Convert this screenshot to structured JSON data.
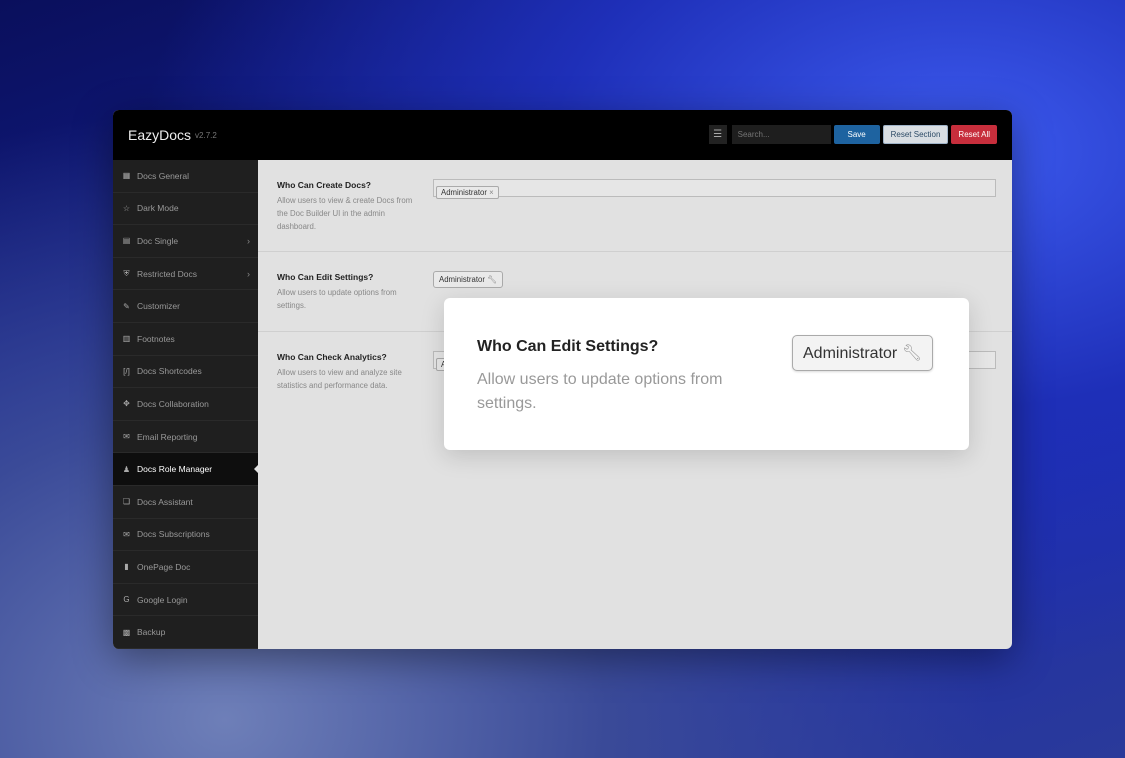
{
  "header": {
    "brand": "EazyDocs",
    "version": "v2.7.2",
    "search_placeholder": "Search...",
    "save": "Save",
    "reset_section": "Reset Section",
    "reset_all": "Reset All"
  },
  "sidebar": {
    "items": [
      {
        "label": "Docs General",
        "icon": "▦"
      },
      {
        "label": "Dark Mode",
        "icon": "☆"
      },
      {
        "label": "Doc Single",
        "icon": "▤",
        "chevron": "›"
      },
      {
        "label": "Restricted Docs",
        "icon": "⛨",
        "chevron": "›"
      },
      {
        "label": "Customizer",
        "icon": "✎"
      },
      {
        "label": "Footnotes",
        "icon": "▥"
      },
      {
        "label": "Docs Shortcodes",
        "icon": "[/]"
      },
      {
        "label": "Docs Collaboration",
        "icon": "✥"
      },
      {
        "label": "Email Reporting",
        "icon": "✉"
      },
      {
        "label": "Docs Role Manager",
        "icon": "♟"
      },
      {
        "label": "Docs Assistant",
        "icon": "❏"
      },
      {
        "label": "Docs Subscriptions",
        "icon": "✉"
      },
      {
        "label": "OnePage Doc",
        "icon": "▮"
      },
      {
        "label": "Google Login",
        "icon": "G"
      },
      {
        "label": "Backup",
        "icon": "▩"
      }
    ]
  },
  "settings": [
    {
      "title": "Who Can Create Docs?",
      "desc": "Allow users to view & create Docs from the Doc Builder UI in the admin dashboard.",
      "value": "Administrator",
      "remove": "×"
    },
    {
      "title": "Who Can Edit Settings?",
      "desc": "Allow users to update options from settings.",
      "value": "Administrator",
      "icon": "wrench"
    },
    {
      "title": "Who Can Check Analytics?",
      "desc": "Allow users to view and analyze site statistics and performance data.",
      "value": "A"
    }
  ],
  "callout": {
    "title": "Who Can Edit Settings?",
    "desc": "Allow users to update options from settings.",
    "value": "Administrator"
  }
}
